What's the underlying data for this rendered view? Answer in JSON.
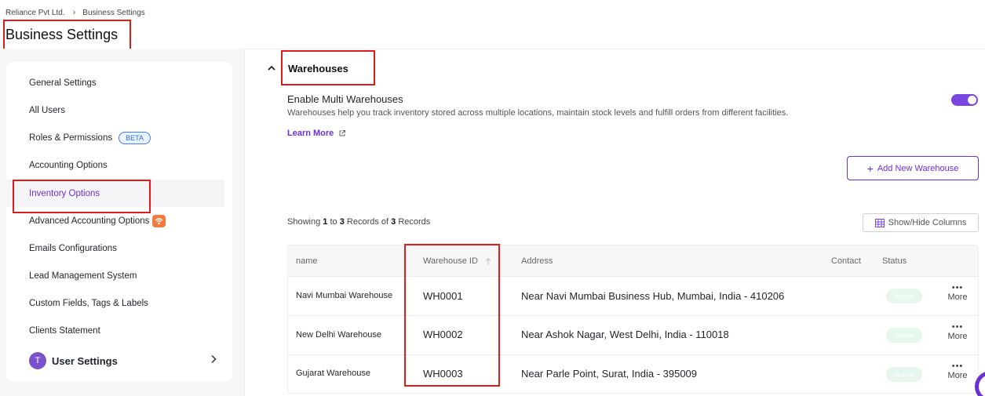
{
  "breadcrumb": {
    "company": "Reliance Pvt Ltd.",
    "current": "Business Settings"
  },
  "page_title": "Business Settings",
  "sidebar": {
    "items": [
      {
        "label": "General Settings"
      },
      {
        "label": "All Users"
      },
      {
        "label": "Roles & Permissions",
        "badge": "BETA"
      },
      {
        "label": "Accounting Options"
      },
      {
        "label": "Inventory Options",
        "active": true
      },
      {
        "label": "Advanced Accounting Options"
      },
      {
        "label": "Emails Configurations"
      },
      {
        "label": "Lead Management System"
      },
      {
        "label": "Custom Fields, Tags & Labels"
      },
      {
        "label": "Clients Statement"
      }
    ],
    "user_settings": {
      "avatar_letter": "T",
      "label": "User Settings"
    }
  },
  "warehouses": {
    "section_title": "Warehouses",
    "multi_title": "Enable Multi Warehouses",
    "multi_desc": "Warehouses help you track inventory stored across multiple locations, maintain stock levels and fulfill orders from different facilities.",
    "learn_more": "Learn More",
    "toggle_on": true,
    "add_button": "Add New Warehouse",
    "records": {
      "prefix": "Showing",
      "from": "1",
      "to_word": "to",
      "to": "3",
      "records_of": "Records of",
      "total": "3",
      "suffix": "Records"
    },
    "show_hide_button": "Show/Hide Columns",
    "columns": {
      "name": "name",
      "id": "Warehouse ID",
      "address": "Address",
      "contact": "Contact",
      "status": "Status"
    },
    "rows": [
      {
        "name": "Navi Mumbai Warehouse",
        "id": "WH0001",
        "address": "Near Navi Mumbai Business Hub, Mumbai, India - 410206",
        "contact": "",
        "status": "Active",
        "more": "More"
      },
      {
        "name": "New Delhi Warehouse",
        "id": "WH0002",
        "address": "Near Ashok Nagar, West Delhi, India - 110018",
        "contact": "",
        "status": "Active",
        "more": "More"
      },
      {
        "name": "Gujarat Warehouse",
        "id": "WH0003",
        "address": "Near Parle Point, Surat, India - 395009",
        "contact": "",
        "status": "Active",
        "more": "More"
      }
    ]
  },
  "colors": {
    "accent": "#6b2fd6",
    "highlight_box": "#e01b1b",
    "status_bg": "#e6f7ee",
    "beta": "#2f6fd6",
    "new_badge": "#f27a3e"
  }
}
